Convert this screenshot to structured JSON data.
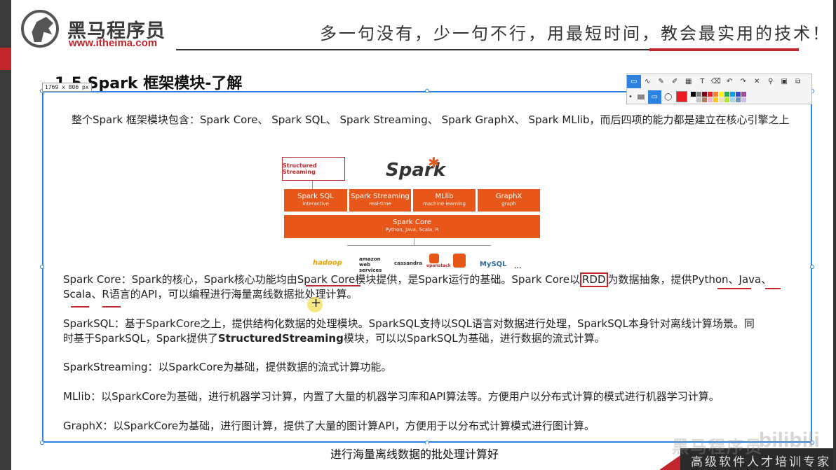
{
  "header": {
    "brand_cn": "黑马程序员",
    "brand_url": "www.itheima.com",
    "slogan": "多一句没有，少一句不行，用最短时间，教会最实用的技术！"
  },
  "slide": {
    "title": "1.5 Spark 框架模块-了解",
    "intro": "整个Spark 框架模块包含：Spark Core、 Spark SQL、 Spark Streaming、 Spark GraphX、 Spark MLlib，而后四项的能力都是建立在核心引擎之上"
  },
  "selection": {
    "dimensions": "1769 x 806  px"
  },
  "toolbar": {
    "tools": [
      "rect-select",
      "line",
      "pen",
      "marker",
      "mosaic",
      "text",
      "eraser",
      "undo",
      "redo",
      "close",
      "pin",
      "save",
      "copy"
    ],
    "colors": [
      "#000000",
      "#7f7f7f",
      "#880015",
      "#ed1c24",
      "#ff7f27",
      "#fff200",
      "#22b14c",
      "#00a2e8",
      "#3f48cc",
      "#a349a4",
      "#ffffff",
      "#c3c3c3",
      "#b97a57",
      "#ffaec9",
      "#ffc90e",
      "#efe4b0",
      "#b5e61d",
      "#99d9ea",
      "#7092be",
      "#c8bfe7"
    ],
    "current_color": "#ed1c24"
  },
  "diagram": {
    "structured_streaming": "Structured Streaming",
    "spark_logo": "Spark",
    "modules": [
      {
        "title": "Spark SQL",
        "sub": "interactive"
      },
      {
        "title": "Spark Streaming",
        "sub": "real-time"
      },
      {
        "title": "MLlib",
        "sub": "machine learning"
      },
      {
        "title": "GraphX",
        "sub": "graph"
      }
    ],
    "core": {
      "title": "Spark Core",
      "sub": "Python, Java, Scala, R"
    },
    "logos": [
      "hadoop",
      "amazon web services",
      "cassandra",
      "openstack",
      "",
      "MySQL",
      "..."
    ]
  },
  "paragraphs": {
    "core_a": "Spark Core：Spark的核心，Spark核心功能均由Spark Core模块提供，是Spark运行的基础。Spark Core以",
    "core_rdd": "RDD",
    "core_b": "为数据抽象，提供Python、Java、",
    "core_line2": "Scala、R语言的API，可以编程进行海量离线数据批处理计算。",
    "sql_line1": "SparkSQL：基于SparkCore之上，提供结构化数据的处理模块。SparkSQL支持以SQL语言对数据进行处理，SparkSQL本身针对离线计算场景。同",
    "sql_line2a": "时基于SparkSQL，Spark提供了",
    "sql_line2b": "StructuredStreaming",
    "sql_line2c": "模块，可以以SparkSQL为基础，进行数据的流式计算。",
    "streaming": "SparkStreaming：以SparkCore为基础，提供数据的流式计算功能。",
    "mllib": "MLlib：以SparkCore为基础，进行机器学习计算，内置了大量的机器学习库和API算法等。方便用户以分布式计算的模式进行机器学习计算。",
    "graphx": "GraphX：以SparkCore为基础，进行图计算，提供了大量的图计算API，方便用于以分布式计算模式进行图计算。"
  },
  "video": {
    "subtitle": "进行海量离线数据的批处理计算好",
    "watermark": "黑马程序员",
    "bilibili": "bilibili",
    "footer": "高级软件人才培训专家"
  }
}
